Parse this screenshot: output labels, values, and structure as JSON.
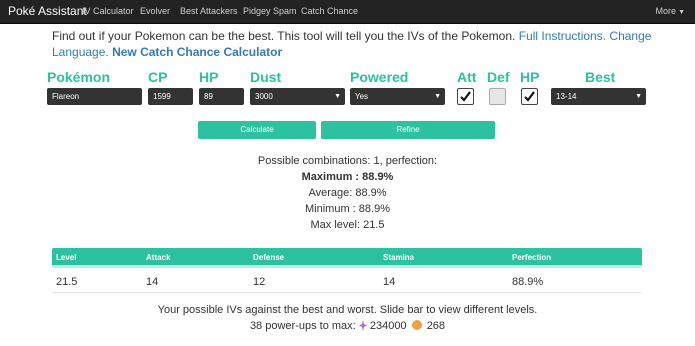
{
  "nav": {
    "brand": "Poké Assistant",
    "links": [
      "IV Calculator",
      "Evolver",
      "Best Attackers",
      "Pidgey Spam",
      "Catch Chance"
    ],
    "more": "More"
  },
  "intro": {
    "text": "Find out if your Pokemon can be the best. This tool will tell you the IVs of the Pokemon.",
    "full_instructions": "Full Instructions",
    "change_language": "Change Language.",
    "new_catch": "New Catch Chance Calculator"
  },
  "form": {
    "labels": {
      "pokemon": "Pokémon",
      "cp": "CP",
      "hp": "HP",
      "dust": "Dust",
      "powered": "Powered",
      "att": "Att",
      "def": "Def",
      "hp_flag": "HP",
      "best": "Best"
    },
    "pokemon_value": "Flareon",
    "cp_value": "1599",
    "hp_value": "89",
    "dust_value": "3000",
    "powered_value": "Yes",
    "att_checked": true,
    "def_checked": false,
    "hp_checked": true,
    "best_value": "13-14",
    "calculate_label": "Calculate",
    "refine_label": "Refine"
  },
  "results": {
    "possible": "Possible combinations: 1, perfection:",
    "maximum": "Maximum : 88.9%",
    "average": "Average: 88.9%",
    "minimum": "Minimum : 88.9%",
    "max_level": "Max level: 21.5"
  },
  "table": {
    "headers": [
      "Level",
      "Attack",
      "Defense",
      "Stamina",
      "Perfection"
    ],
    "row": [
      "21.5",
      "14",
      "12",
      "14",
      "88.9%"
    ]
  },
  "footer": {
    "ivs_text": "Your possible IVs against the best and worst. Slide bar to view different levels.",
    "powerups_text": "38 power-ups to max:",
    "stardust_value": "234000",
    "candy_value": "268"
  },
  "colors": {
    "accent": "#2dc29f",
    "navbar": "#222222",
    "link": "#337ab7",
    "candy": "#f1a33a"
  }
}
